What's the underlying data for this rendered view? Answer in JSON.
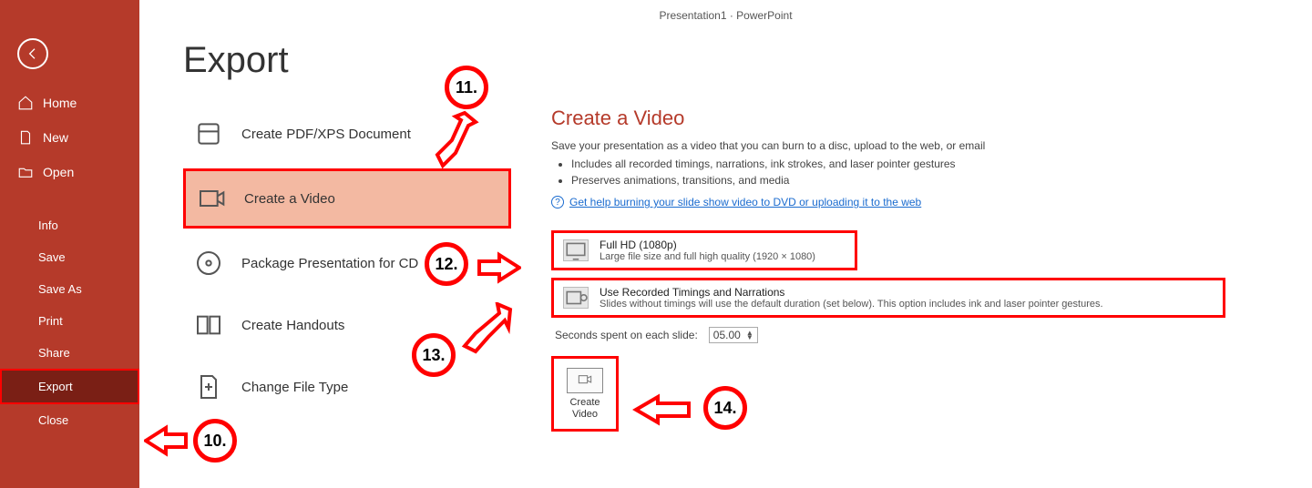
{
  "window_title": "Presentation1 · PowerPoint",
  "page_title": "Export",
  "sidebar": {
    "top": [
      {
        "label": "Home",
        "icon": "home-icon"
      },
      {
        "label": "New",
        "icon": "new-icon"
      },
      {
        "label": "Open",
        "icon": "open-icon"
      }
    ],
    "bottom": [
      {
        "label": "Info"
      },
      {
        "label": "Save"
      },
      {
        "label": "Save As"
      },
      {
        "label": "Print"
      },
      {
        "label": "Share"
      },
      {
        "label": "Export",
        "selected": true
      },
      {
        "label": "Close"
      }
    ]
  },
  "export_types": [
    {
      "label": "Create PDF/XPS Document",
      "icon": "pdf-icon"
    },
    {
      "label": "Create a Video",
      "icon": "video-icon",
      "selected": true
    },
    {
      "label": "Package Presentation for CD",
      "icon": "cd-icon"
    },
    {
      "label": "Create Handouts",
      "icon": "handouts-icon"
    },
    {
      "label": "Change File Type",
      "icon": "filetype-icon"
    }
  ],
  "detail": {
    "title": "Create a Video",
    "description": "Save your presentation as a video that you can burn to a disc, upload to the web, or email",
    "bullets": [
      "Includes all recorded timings, narrations, ink strokes, and laser pointer gestures",
      "Preserves animations, transitions, and media"
    ],
    "help_text": "Get help burning your slide show video to DVD or uploading it to the web",
    "quality_dropdown": {
      "title": "Full HD (1080p)",
      "subtitle": "Large file size and full high quality (1920 × 1080)"
    },
    "timings_dropdown": {
      "title": "Use Recorded Timings and Narrations",
      "subtitle": "Slides without timings will use the default duration (set below). This option includes ink and laser pointer gestures."
    },
    "seconds_label": "Seconds spent on each slide:",
    "seconds_value": "05.00",
    "create_button_label": "Create\nVideo"
  },
  "callouts": {
    "c10": "10.",
    "c11": "11.",
    "c12": "12.",
    "c13": "13.",
    "c14": "14."
  }
}
